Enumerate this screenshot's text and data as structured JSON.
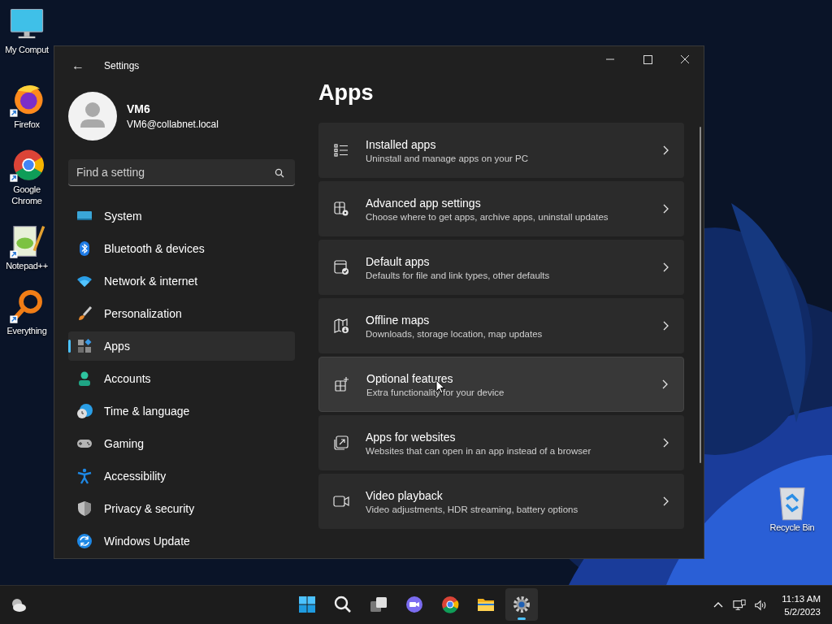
{
  "desktop_icons": [
    {
      "kind": "computer",
      "label": "My Comput"
    },
    {
      "kind": "firefox",
      "label": "Firefox"
    },
    {
      "kind": "chrome",
      "label": "Google Chrome"
    },
    {
      "kind": "notepad",
      "label": "Notepad++"
    },
    {
      "kind": "everything",
      "label": "Everything"
    },
    {
      "kind": "recycle",
      "label": "Recycle Bin"
    }
  ],
  "window": {
    "title": "Settings",
    "back": "←"
  },
  "profile": {
    "name": "VM6",
    "email": "VM6@collabnet.local"
  },
  "search": {
    "placeholder": "Find a setting"
  },
  "sidebar": {
    "items": [
      {
        "kind": "system",
        "label": "System",
        "selected": false
      },
      {
        "kind": "bluetooth",
        "label": "Bluetooth & devices",
        "selected": false
      },
      {
        "kind": "network",
        "label": "Network & internet",
        "selected": false
      },
      {
        "kind": "personalization",
        "label": "Personalization",
        "selected": false
      },
      {
        "kind": "apps",
        "label": "Apps",
        "selected": true
      },
      {
        "kind": "accounts",
        "label": "Accounts",
        "selected": false
      },
      {
        "kind": "time",
        "label": "Time & language",
        "selected": false
      },
      {
        "kind": "gaming",
        "label": "Gaming",
        "selected": false
      },
      {
        "kind": "accessibility",
        "label": "Accessibility",
        "selected": false
      },
      {
        "kind": "privacy",
        "label": "Privacy & security",
        "selected": false
      },
      {
        "kind": "update",
        "label": "Windows Update",
        "selected": false
      }
    ]
  },
  "page": {
    "title": "Apps",
    "cards": [
      {
        "kind": "list",
        "title": "Installed apps",
        "subtitle": "Uninstall and manage apps on your PC",
        "hovered": false
      },
      {
        "kind": "gear",
        "title": "Advanced app settings",
        "subtitle": "Choose where to get apps, archive apps, uninstall updates",
        "hovered": false
      },
      {
        "kind": "check",
        "title": "Default apps",
        "subtitle": "Defaults for file and link types, other defaults",
        "hovered": false
      },
      {
        "kind": "map",
        "title": "Offline maps",
        "subtitle": "Downloads, storage location, map updates",
        "hovered": false
      },
      {
        "kind": "plus",
        "title": "Optional features",
        "subtitle": "Extra functionality for your device",
        "hovered": true
      },
      {
        "kind": "web",
        "title": "Apps for websites",
        "subtitle": "Websites that can open in an app instead of a browser",
        "hovered": false
      },
      {
        "kind": "video",
        "title": "Video playback",
        "subtitle": "Video adjustments, HDR streaming, battery options",
        "hovered": false
      }
    ]
  },
  "taskbar": {
    "apps": [
      {
        "kind": "start",
        "active": false
      },
      {
        "kind": "search",
        "active": false
      },
      {
        "kind": "taskview",
        "active": false
      },
      {
        "kind": "chat",
        "active": false
      },
      {
        "kind": "chrome",
        "active": false
      },
      {
        "kind": "explorer",
        "active": false
      },
      {
        "kind": "settings",
        "active": true
      }
    ],
    "time": "11:13 AM",
    "date": "5/2/2023"
  }
}
